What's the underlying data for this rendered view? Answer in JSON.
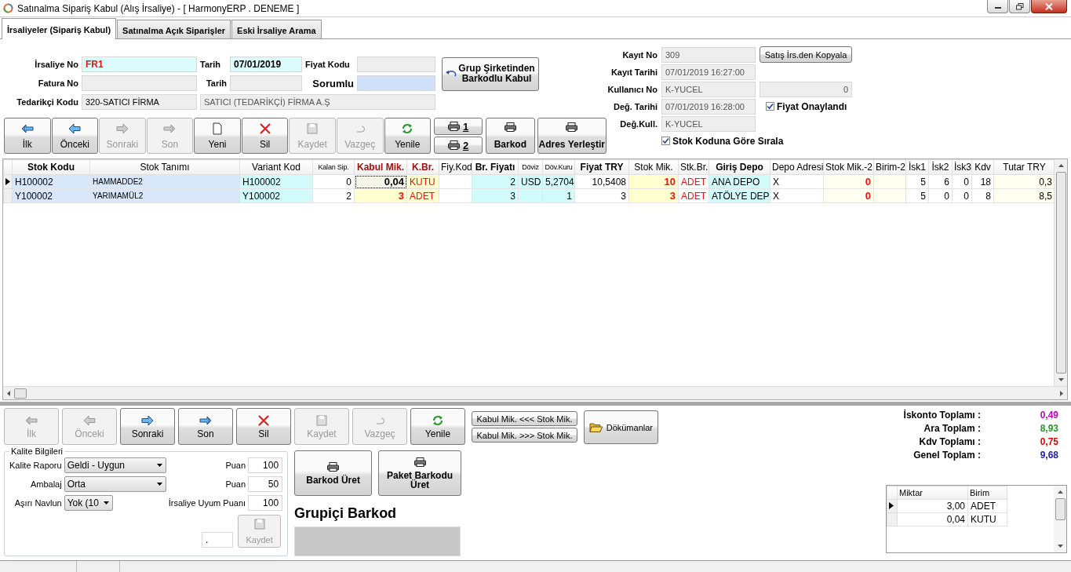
{
  "window": {
    "title": "Satınalma Sipariş Kabul (Alış İrsaliye) - [ HarmonyERP . DENEME ]"
  },
  "tabs": [
    {
      "label": "İrsaliyeler (Sipariş Kabul)",
      "selected": true
    },
    {
      "label": "Satınalma Açık Siparişler",
      "selected": false
    },
    {
      "label": "Eski İrsaliye Arama",
      "selected": false
    }
  ],
  "header": {
    "irsaliye_no": {
      "label": "İrsaliye No",
      "value": "FR1"
    },
    "tarih": {
      "label": "Tarih",
      "value": "07/01/2019"
    },
    "fiyat_kodu": {
      "label": "Fiyat Kodu"
    },
    "fatura_no": {
      "label": "Fatura No"
    },
    "fatura_tarih": {
      "label": "Tarih"
    },
    "sorumlu": {
      "label": "Sorumlu"
    },
    "tedarikci": {
      "label": "Tedarikçi Kodu",
      "code": "320-SATICI FİRMA",
      "name": "SATICI (TEDARİKÇİ) FİRMA A.Ş"
    },
    "group_button": "Grup Şirketinden Barkodlu Kabul"
  },
  "toolbar": [
    {
      "label": "İlk",
      "kind": "first",
      "disabled": false
    },
    {
      "label": "Önceki",
      "kind": "prev",
      "disabled": false
    },
    {
      "label": "Sonraki",
      "kind": "next",
      "disabled": true
    },
    {
      "label": "Son",
      "kind": "last",
      "disabled": true
    },
    {
      "label": "Yeni",
      "kind": "new",
      "disabled": false
    },
    {
      "label": "Sil",
      "kind": "delete",
      "disabled": false
    },
    {
      "label": "Kaydet",
      "kind": "save",
      "disabled": true
    },
    {
      "label": "Vazgeç",
      "kind": "cancel",
      "disabled": true
    },
    {
      "label": "Yenile",
      "kind": "refresh",
      "disabled": false
    }
  ],
  "print_buttons": [
    "1",
    "2"
  ],
  "barkod_button": "Barkod",
  "adres_button": "Adres Yerleştir",
  "record": {
    "kayit_no": {
      "label": "Kayıt No",
      "value": "309"
    },
    "copy_button": "Satış İrs.den Kopyala",
    "kayit_tarihi": {
      "label": "Kayıt Tarihi",
      "value": "07/01/2019 16:27:00"
    },
    "kullanici_no": {
      "label": "Kullanıcı No",
      "value": "K-YUCEL",
      "extra": "0"
    },
    "deg_tarihi": {
      "label": "Değ. Tarihi",
      "value": "07/01/2019 16:28:00"
    },
    "fiyat_onaylandi": {
      "label": "Fiyat Onaylandı",
      "checked": true
    },
    "deg_kull": {
      "label": "Değ.Kull.",
      "value": "K-YUCEL"
    },
    "sort_by_code": {
      "label": "Stok Koduna Göre Sırala",
      "checked": true
    }
  },
  "grid": {
    "columns": [
      "Stok Kodu",
      "Stok Tanımı",
      "Variant Kod",
      "Kalan Sip.",
      "Kabul Mik.",
      "K.Br.",
      "Fiy.Kod",
      "Br. Fiyatı",
      "Döviz",
      "Döv.Kuru",
      "Fiyat TRY",
      "Stok Mik.",
      "Stk.Br.",
      "Giriş Depo",
      "Depo Adresi",
      "Stok Mik.-2",
      "Birim-2",
      "İsk1",
      "İsk2",
      "İsk3",
      "Kdv",
      "Tutar TRY"
    ],
    "rows": [
      {
        "selected": true,
        "editing": true,
        "cells": [
          "H100002",
          "HAMMADDE2",
          "H100002",
          "0",
          "0,04",
          "KUTU",
          null,
          "2",
          "USD",
          "5,2704",
          "10,5408",
          "10",
          "ADET",
          "ANA DEPO",
          "X",
          "0",
          null,
          "5",
          "6",
          "0",
          "18",
          "0,3"
        ]
      },
      {
        "selected": false,
        "editing": false,
        "cells": [
          "Y100002",
          "YARIMAMÜL2",
          "Y100002",
          "2",
          "3",
          "ADET",
          null,
          "3",
          null,
          "1",
          "3",
          "3",
          "ADET",
          "ATÖLYE DEP",
          "X",
          "0",
          null,
          "5",
          "0",
          "0",
          "8",
          "8,5"
        ]
      }
    ]
  },
  "bottom_toolbar": [
    {
      "label": "İlk",
      "kind": "first",
      "disabled": true
    },
    {
      "label": "Önceki",
      "kind": "prev",
      "disabled": true
    },
    {
      "label": "Sonraki",
      "kind": "next",
      "disabled": false
    },
    {
      "label": "Son",
      "kind": "last",
      "disabled": false
    },
    {
      "label": "Sil",
      "kind": "delete",
      "disabled": false
    },
    {
      "label": "Kaydet",
      "kind": "save",
      "disabled": true
    },
    {
      "label": "Vazgeç",
      "kind": "cancel",
      "disabled": true
    },
    {
      "label": "Yenile",
      "kind": "refresh",
      "disabled": false
    }
  ],
  "transfer_buttons": [
    "Kabul Mik. <<< Stok Mik.",
    "Kabul Mik. >>> Stok Mik."
  ],
  "documents_button": "Dökümanlar",
  "quality": {
    "title": "Kalite Bilgileri",
    "rows": [
      {
        "label": "Kalite Raporu",
        "value": "Geldi - Uygun",
        "score_label": "Puan",
        "score": "100"
      },
      {
        "label": "Ambalaj",
        "value": "Orta",
        "score_label": "Puan",
        "score": "50"
      },
      {
        "label": "Aşırı Navlun",
        "value": "Yok (10",
        "score_label": "İrsaliye Uyum Puanı",
        "score": "100"
      }
    ],
    "note": ".",
    "save_button": {
      "label": "Kaydet",
      "disabled": true
    }
  },
  "barcode": {
    "buttons": [
      "Barkod Üret",
      "Paket Barkodu Üret"
    ],
    "title": "Grupiçi Barkod"
  },
  "totals": [
    {
      "label": "İskonto Toplamı :",
      "value": "0,49",
      "color": "#c000c0"
    },
    {
      "label": "Ara Toplam :",
      "value": "8,93",
      "color": "#2a9a2a"
    },
    {
      "label": "Kdv Toplamı :",
      "value": "0,75",
      "color": "#e00000"
    },
    {
      "label": "Genel Toplam :",
      "value": "9,68",
      "color": "#2020b0"
    }
  ],
  "units": {
    "columns": [
      "Miktar",
      "Birim"
    ],
    "rows": [
      {
        "selected": true,
        "cells": [
          "3,00",
          "ADET"
        ]
      },
      {
        "selected": false,
        "cells": [
          "0,04",
          "KUTU"
        ]
      }
    ]
  }
}
